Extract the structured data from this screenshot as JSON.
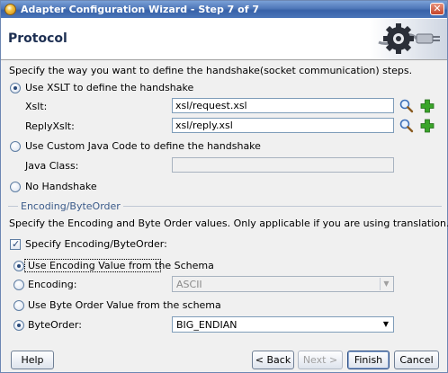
{
  "window": {
    "title": "Adapter Configuration Wizard - Step 7 of 7",
    "close_label": "✕"
  },
  "header": {
    "page_title": "Protocol"
  },
  "main": {
    "intro": "Specify the way you want to define the handshake(socket communication) steps.",
    "option_xslt": "Use XSLT to define the handshake",
    "xslt_label": "Xslt:",
    "xslt_value": "xsl/request.xsl",
    "reply_label": "ReplyXslt:",
    "reply_value": "xsl/reply.xsl",
    "option_custom": "Use Custom Java Code to define the handshake",
    "java_class_label": "Java Class:",
    "java_class_value": "",
    "option_none": "No Handshake",
    "section_title": "Encoding/ByteOrder",
    "section_desc": "Specify the Encoding and Byte Order values. Only applicable if you are using translation.",
    "specify_checkbox": "Specify Encoding/ByteOrder:",
    "use_encoding_schema": "Use Encoding Value from the Schema",
    "encoding_label": "Encoding:",
    "encoding_value": "ASCII",
    "use_byte_schema": "Use Byte Order Value from the schema",
    "byteorder_label": "ByteOrder:",
    "byteorder_value": "BIG_ENDIAN"
  },
  "footer": {
    "help": "Help",
    "back": "< Back",
    "next": "Next >",
    "finish": "Finish",
    "cancel": "Cancel"
  },
  "colors": {
    "titlebar": "#3862a8",
    "accent": "#2a4a7a",
    "add_icon": "#3aa52a"
  }
}
